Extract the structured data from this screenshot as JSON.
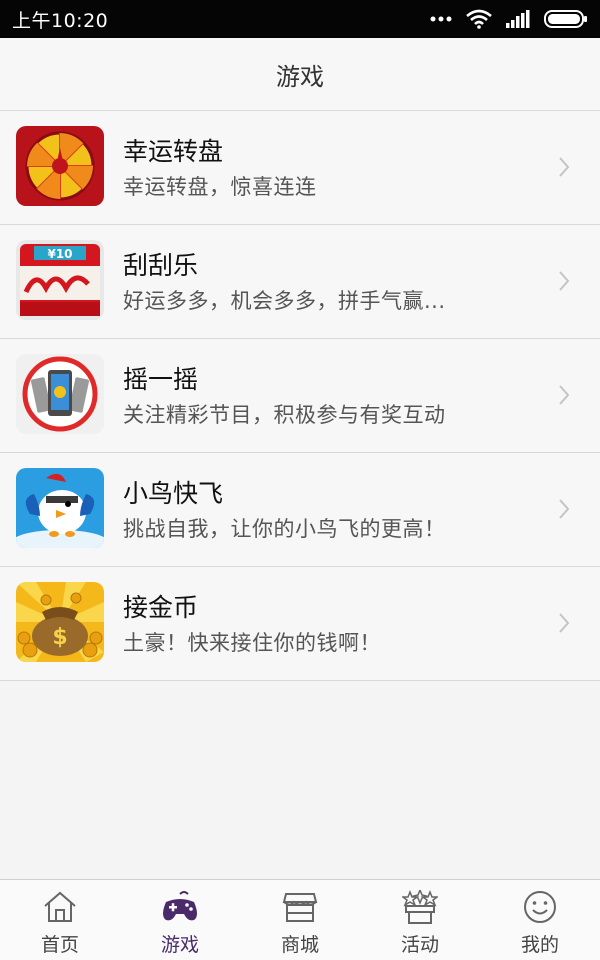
{
  "status_bar": {
    "time": "上午10:20"
  },
  "header": {
    "title": "游戏"
  },
  "games": [
    {
      "title": "幸运转盘",
      "desc": "幸运转盘，惊喜连连",
      "icon": "prize-wheel-icon"
    },
    {
      "title": "刮刮乐",
      "desc": "好运多多，机会多多，拼手气赢...",
      "icon": "scratch-card-icon"
    },
    {
      "title": "摇一摇",
      "desc": "关注精彩节目，积极参与有奖互动",
      "icon": "shake-phone-icon"
    },
    {
      "title": "小鸟快飞",
      "desc": "挑战自我，让你的小鸟飞的更高！",
      "icon": "bird-icon"
    },
    {
      "title": "接金币",
      "desc": "土豪！快来接住你的钱啊！",
      "icon": "gold-coin-bag-icon"
    }
  ],
  "tabs": [
    {
      "label": "首页",
      "icon": "home-icon",
      "active": false
    },
    {
      "label": "游戏",
      "icon": "gamepad-icon",
      "active": true
    },
    {
      "label": "商城",
      "icon": "store-icon",
      "active": false
    },
    {
      "label": "活动",
      "icon": "gift-icon",
      "active": false
    },
    {
      "label": "我的",
      "icon": "smiley-icon",
      "active": false
    }
  ],
  "colors": {
    "status_bar_bg": "#050505",
    "active_tab": "#4a2a6a",
    "background": "#f4f4f4"
  }
}
